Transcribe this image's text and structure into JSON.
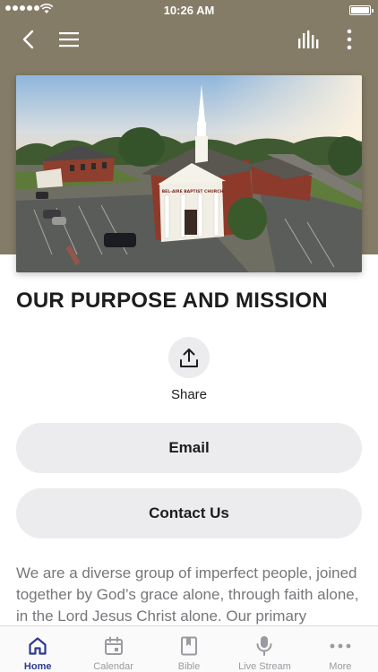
{
  "status_bar": {
    "time": "10:26 AM"
  },
  "colors": {
    "header": "#857c67",
    "active_tab": "#2e3a8c",
    "inactive_tab": "#9a9aa0",
    "button_bg": "#ececee"
  },
  "nav": {
    "icons": [
      "back-chevron-icon",
      "hamburger-menu-icon",
      "audio-bars-icon",
      "more-vertical-icon"
    ]
  },
  "hero": {
    "sign_text": "BEL-AIRE BAPTIST CHURCH"
  },
  "page": {
    "title": "OUR PURPOSE AND MISSION",
    "share_label": "Share",
    "email_label": "Email",
    "contact_label": "Contact Us",
    "body": "We are a diverse group of imperfect people, joined together by God’s grace alone, through faith alone, in the Lord Jesus Christ alone. Our primary purpose"
  },
  "tabs": [
    {
      "label": "Home",
      "icon": "home-icon",
      "active": true
    },
    {
      "label": "Calendar",
      "icon": "calendar-icon",
      "active": false
    },
    {
      "label": "Bible",
      "icon": "bible-icon",
      "active": false
    },
    {
      "label": "Live Stream",
      "icon": "microphone-icon",
      "active": false
    },
    {
      "label": "More",
      "icon": "more-horizontal-icon",
      "active": false
    }
  ]
}
